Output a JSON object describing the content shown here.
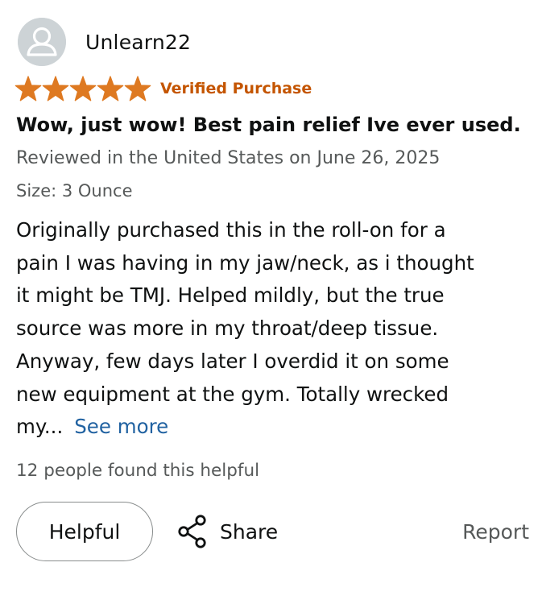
{
  "reviewer": {
    "name": "Unlearn22",
    "avatar_icon": "default-user-avatar-icon"
  },
  "rating": {
    "stars": 5,
    "max_stars": 5,
    "star_color": "#de7921",
    "badge": "Verified Purchase",
    "badge_color": "#c45500"
  },
  "review": {
    "title": "Wow, just wow! Best pain relief Ive ever used.",
    "date": "Reviewed in the United States on June 26, 2025",
    "size": "Size: 3 Ounce",
    "body_lines": [
      "Originally purchased this in the roll-on for a",
      "pain I was having in my jaw/neck, as i thought",
      "it might be TMJ. Helped mildly, but the true",
      "source was more in my throat/deep tissue.",
      "Anyway, few days later I overdid it on some",
      "new equipment at the gym. Totally wrecked",
      "my..."
    ],
    "see_more": "See more",
    "link_color": "#2162a1"
  },
  "helpful_count_text": "12 people found this helpful",
  "actions": {
    "helpful": "Helpful",
    "share": "Share",
    "share_icon": "share-icon",
    "report": "Report"
  }
}
